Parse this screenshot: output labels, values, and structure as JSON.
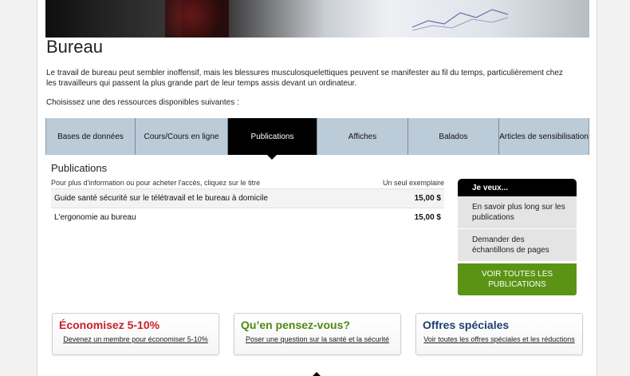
{
  "page": {
    "title": "Bureau",
    "intro": "Le travail de bureau peut sembler inoffensif, mais les blessures musculosquelettiques peuvent se manifester au fil du temps, particulièrement chez les travailleurs qui passent la plus grande part de leur temps assis devant un ordinateur.",
    "choose": "Choisissez une des ressources disponibles suivantes :"
  },
  "tabs": [
    {
      "label": "Bases de données"
    },
    {
      "label": "Cours/Cours en ligne"
    },
    {
      "label": "Publications",
      "active": true
    },
    {
      "label": "Affiches"
    },
    {
      "label": "Balados"
    },
    {
      "label": "Articles de sensibilisation"
    }
  ],
  "publications": {
    "heading": "Publications",
    "instruction": "Pour plus d'information ou pour acheter l'accès, cliquez sur le titre",
    "price_header": "Un seul exemplaire",
    "rows": [
      {
        "title": "Guide santé sécurité sur le télétravail et le bureau à domicile",
        "price": "15,00 $"
      },
      {
        "title": "L'ergonomie au bureau",
        "price": "15,00 $"
      }
    ]
  },
  "jeveux": {
    "heading": "Je veux...",
    "items": [
      "En savoir plus long sur les publications",
      "Demander des échantillons de pages"
    ],
    "button": "VOIR TOUTES LES PUBLICATIONS"
  },
  "promos": [
    {
      "heading": "Économisez 5-10%",
      "link": "Devenez un membre pour économiser 5-10%"
    },
    {
      "heading": "Qu’en pensez-vous?",
      "link": "Poser une question sur la santé et la sécurité"
    },
    {
      "heading": "Offres spéciales",
      "link": "Voir toutes les offres spéciales et les réductions"
    }
  ],
  "colors": {
    "tab_bg": "#bccbd8",
    "tab_active": "#000000",
    "green_button": "#5b9414",
    "promo_red": "#c8202b",
    "promo_green": "#4e8a12",
    "promo_blue": "#1f3e6e"
  }
}
